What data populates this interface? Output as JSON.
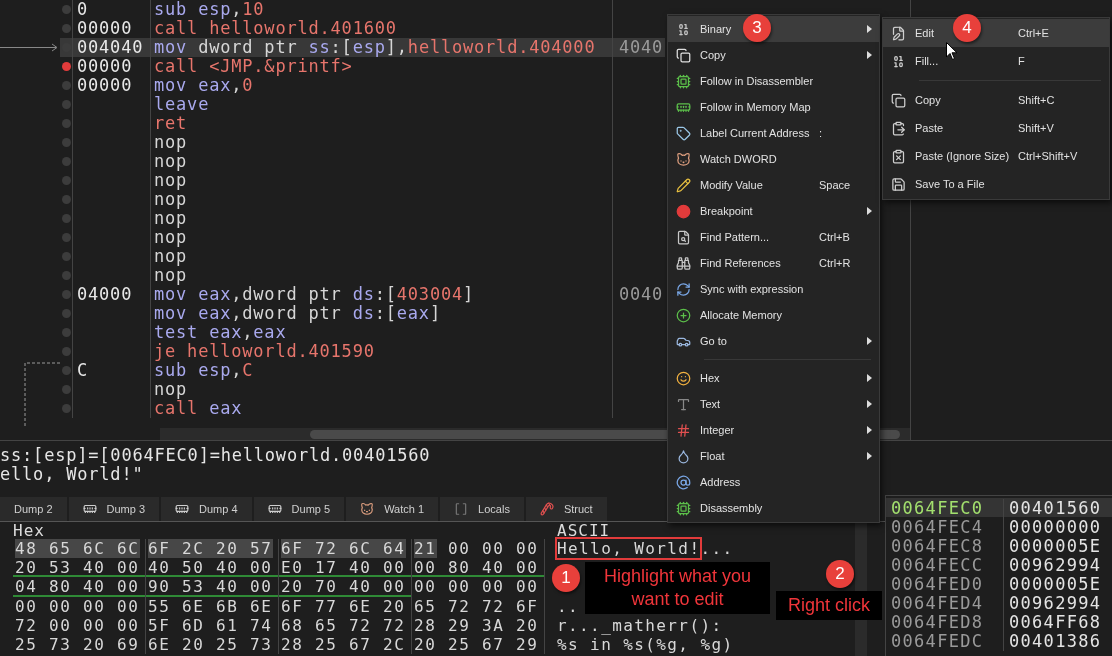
{
  "disassembly": {
    "rows": [
      {
        "address": "0",
        "selected": false,
        "breakpoint": false,
        "instruction": [
          {
            "text": "sub",
            "kind": "op"
          },
          {
            "text": " esp",
            "kind": "reg"
          },
          {
            "text": ",",
            "kind": "plain"
          },
          {
            "text": "10",
            "kind": "num"
          }
        ]
      },
      {
        "address": "00000",
        "selected": false,
        "breakpoint": false,
        "instruction": [
          {
            "text": "call",
            "kind": "flow"
          },
          {
            "text": " helloworld.401600",
            "kind": "num"
          }
        ]
      },
      {
        "address": "004040",
        "selected": true,
        "breakpoint": false,
        "instruction": [
          {
            "text": "mov",
            "kind": "op"
          },
          {
            "text": " dword ptr ",
            "kind": "plain"
          },
          {
            "text": "ss",
            "kind": "reg"
          },
          {
            "text": ":[",
            "kind": "plain"
          },
          {
            "text": "esp",
            "kind": "reg"
          },
          {
            "text": "],",
            "kind": "plain"
          },
          {
            "text": "helloworld.404000",
            "kind": "num"
          }
        ],
        "extra": "4040"
      },
      {
        "address": "00000",
        "selected": false,
        "breakpoint": true,
        "instruction": [
          {
            "text": "call",
            "kind": "flow"
          },
          {
            "text": " <JMP.&printf>",
            "kind": "num"
          }
        ]
      },
      {
        "address": "00000",
        "selected": false,
        "breakpoint": false,
        "instruction": [
          {
            "text": "mov",
            "kind": "op"
          },
          {
            "text": " eax",
            "kind": "reg"
          },
          {
            "text": ",",
            "kind": "plain"
          },
          {
            "text": "0",
            "kind": "num"
          }
        ]
      },
      {
        "selected": false,
        "breakpoint": false,
        "instruction": [
          {
            "text": "leave",
            "kind": "op"
          }
        ]
      },
      {
        "selected": false,
        "breakpoint": false,
        "instruction": [
          {
            "text": "ret",
            "kind": "flow"
          }
        ]
      },
      {
        "selected": false,
        "breakpoint": false,
        "instruction": [
          {
            "text": "nop",
            "kind": "plain"
          }
        ]
      },
      {
        "selected": false,
        "breakpoint": false,
        "instruction": [
          {
            "text": "nop",
            "kind": "plain"
          }
        ]
      },
      {
        "selected": false,
        "breakpoint": false,
        "instruction": [
          {
            "text": "nop",
            "kind": "plain"
          }
        ]
      },
      {
        "selected": false,
        "breakpoint": false,
        "instruction": [
          {
            "text": "nop",
            "kind": "plain"
          }
        ]
      },
      {
        "selected": false,
        "breakpoint": false,
        "instruction": [
          {
            "text": "nop",
            "kind": "plain"
          }
        ]
      },
      {
        "selected": false,
        "breakpoint": false,
        "instruction": [
          {
            "text": "nop",
            "kind": "plain"
          }
        ]
      },
      {
        "selected": false,
        "breakpoint": false,
        "instruction": [
          {
            "text": "nop",
            "kind": "plain"
          }
        ]
      },
      {
        "selected": false,
        "breakpoint": false,
        "instruction": [
          {
            "text": "nop",
            "kind": "plain"
          }
        ]
      },
      {
        "address": "04000",
        "selected": false,
        "breakpoint": false,
        "instruction": [
          {
            "text": "mov",
            "kind": "op"
          },
          {
            "text": " eax",
            "kind": "reg"
          },
          {
            "text": ",dword ptr ",
            "kind": "plain"
          },
          {
            "text": "ds",
            "kind": "reg"
          },
          {
            "text": ":[",
            "kind": "plain"
          },
          {
            "text": "403004",
            "kind": "num"
          },
          {
            "text": "]",
            "kind": "plain"
          }
        ],
        "extra": "0040"
      },
      {
        "selected": false,
        "breakpoint": false,
        "instruction": [
          {
            "text": "mov",
            "kind": "op"
          },
          {
            "text": " eax",
            "kind": "reg"
          },
          {
            "text": ",dword ptr ",
            "kind": "plain"
          },
          {
            "text": "ds",
            "kind": "reg"
          },
          {
            "text": ":[",
            "kind": "plain"
          },
          {
            "text": "eax",
            "kind": "reg"
          },
          {
            "text": "]",
            "kind": "plain"
          }
        ]
      },
      {
        "selected": false,
        "breakpoint": false,
        "instruction": [
          {
            "text": "test",
            "kind": "op"
          },
          {
            "text": " eax",
            "kind": "reg"
          },
          {
            "text": ",",
            "kind": "plain"
          },
          {
            "text": "eax",
            "kind": "reg"
          }
        ]
      },
      {
        "selected": false,
        "breakpoint": false,
        "instruction": [
          {
            "text": "je",
            "kind": "flow"
          },
          {
            "text": " helloworld.401590",
            "kind": "num"
          }
        ]
      },
      {
        "address": "C",
        "selected": false,
        "breakpoint": false,
        "instruction": [
          {
            "text": "sub",
            "kind": "op"
          },
          {
            "text": " esp",
            "kind": "reg"
          },
          {
            "text": ",",
            "kind": "plain"
          },
          {
            "text": "C",
            "kind": "num"
          }
        ]
      },
      {
        "selected": false,
        "breakpoint": false,
        "instruction": [
          {
            "text": "nop",
            "kind": "plain"
          }
        ]
      },
      {
        "selected": false,
        "breakpoint": false,
        "instruction": [
          {
            "text": "call",
            "kind": "flow"
          },
          {
            "text": " eax",
            "kind": "reg"
          }
        ]
      }
    ]
  },
  "info": [
    "ss:[esp]=[0064FEC0]=helloworld.00401560",
    "ello, World!\""
  ],
  "tabs": [
    {
      "label": "Dump 2",
      "selected": false
    },
    {
      "label": "Dump 3",
      "selected": false
    },
    {
      "label": "Dump 4",
      "selected": false
    },
    {
      "label": "Dump 5",
      "selected": false
    },
    {
      "label": "Watch 1",
      "selected": false
    },
    {
      "label": "Locals",
      "selected": false
    },
    {
      "label": "Struct",
      "selected": false
    }
  ],
  "dump": {
    "hex_header": "Hex",
    "ascii_header": "ASCII",
    "rows": [
      {
        "groups": [
          {
            "underlined": false,
            "spans": [
              {
                "text": "48 65 6C 6C",
                "selected": true
              }
            ]
          },
          {
            "underlined": false,
            "spans": [
              {
                "text": "6F 2C 20 57",
                "selected": true
              }
            ]
          },
          {
            "underlined": false,
            "spans": [
              {
                "text": "6F 72 6C 64",
                "selected": true
              }
            ]
          },
          {
            "underlined": false,
            "spans": [
              {
                "text": "21",
                "selected": true
              },
              {
                "text": " 00 00 00",
                "selected": false
              }
            ]
          }
        ],
        "ascii": [
          {
            "text": "Hello, World!",
            "outlined": true
          },
          {
            "text": "...",
            "outlined": false
          }
        ]
      },
      {
        "groups": [
          {
            "underlined": true,
            "spans": [
              {
                "text": "20 53 40 00",
                "selected": false
              }
            ]
          },
          {
            "underlined": true,
            "spans": [
              {
                "text": "40 50 40 00",
                "selected": false
              }
            ]
          },
          {
            "underlined": true,
            "spans": [
              {
                "text": "E0 17 40 00",
                "selected": false
              }
            ]
          },
          {
            "underlined": true,
            "spans": [
              {
                "text": "00 80 40 00",
                "selected": false
              }
            ]
          }
        ]
      },
      {
        "groups": [
          {
            "underlined": true,
            "spans": [
              {
                "text": "04 80 40 00",
                "selected": false
              }
            ]
          },
          {
            "underlined": true,
            "spans": [
              {
                "text": "90 53 40 00",
                "selected": false
              }
            ]
          },
          {
            "underlined": true,
            "spans": [
              {
                "text": "20 70 40 00",
                "selected": false
              }
            ]
          },
          {
            "underlined": false,
            "spans": [
              {
                "text": "00 00 00 00",
                "selected": false
              }
            ]
          }
        ]
      },
      {
        "groups": [
          {
            "underlined": false,
            "spans": [
              {
                "text": "00 00 00 00",
                "selected": false
              }
            ]
          },
          {
            "underlined": false,
            "spans": [
              {
                "text": "55 6E 6B 6E",
                "selected": false
              }
            ]
          },
          {
            "underlined": false,
            "spans": [
              {
                "text": "6F 77 6E 20",
                "selected": false
              }
            ]
          },
          {
            "underlined": false,
            "spans": [
              {
                "text": "65 72 72 6F",
                "selected": false
              }
            ]
          }
        ],
        "ascii": [
          {
            "text": "..",
            "outlined": false
          }
        ]
      },
      {
        "groups": [
          {
            "underlined": false,
            "spans": [
              {
                "text": "72 00 00 00",
                "selected": false
              }
            ]
          },
          {
            "underlined": false,
            "spans": [
              {
                "text": "5F 6D 61 74",
                "selected": false
              }
            ]
          },
          {
            "underlined": false,
            "spans": [
              {
                "text": "68 65 72 72",
                "selected": false
              }
            ]
          },
          {
            "underlined": false,
            "spans": [
              {
                "text": "28 29 3A 20",
                "selected": false
              }
            ]
          }
        ],
        "ascii": [
          {
            "text": "r..._matherr():",
            "outlined": false
          }
        ]
      },
      {
        "groups": [
          {
            "underlined": false,
            "spans": [
              {
                "text": "25 73 20 69",
                "selected": false
              }
            ]
          },
          {
            "underlined": false,
            "spans": [
              {
                "text": "6E 20 25 73",
                "selected": false
              }
            ]
          },
          {
            "underlined": false,
            "spans": [
              {
                "text": "28 25 67 2C",
                "selected": false
              }
            ]
          },
          {
            "underlined": false,
            "spans": [
              {
                "text": "20 25 67 29",
                "selected": false
              }
            ]
          }
        ],
        "ascii": [
          {
            "text": "%s in %s(%g, %g)",
            "outlined": false
          }
        ]
      }
    ]
  },
  "stack": [
    {
      "address": "0064FEC0",
      "value": "00401560",
      "selected": true
    },
    {
      "address": "0064FEC4",
      "value": "00000000",
      "selected": false
    },
    {
      "address": "0064FEC8",
      "value": "0000005E",
      "selected": false
    },
    {
      "address": "0064FECC",
      "value": "00962994",
      "selected": false
    },
    {
      "address": "0064FED0",
      "value": "0000005E",
      "selected": false
    },
    {
      "address": "0064FED4",
      "value": "00962994",
      "selected": false
    },
    {
      "address": "0064FED8",
      "value": "0064FF68",
      "selected": false
    },
    {
      "address": "0064FEDC",
      "value": "00401386",
      "selected": false
    }
  ],
  "context_menu": {
    "items": [
      {
        "label": "Binary",
        "selected": true,
        "submenu": true
      },
      {
        "label": "Copy",
        "selected": false,
        "submenu": true
      },
      {
        "label": "Follow in Disassembler",
        "selected": false,
        "submenu": false
      },
      {
        "label": "Follow in Memory Map",
        "selected": false,
        "submenu": false
      },
      {
        "label": "Label Current Address",
        "shortcut": ":",
        "selected": false,
        "submenu": false
      },
      {
        "label": "Watch DWORD",
        "selected": false,
        "submenu": false
      },
      {
        "label": "Modify Value",
        "shortcut": "Space",
        "selected": false,
        "submenu": false
      },
      {
        "label": "Breakpoint",
        "selected": false,
        "submenu": true
      },
      {
        "label": "Find Pattern...",
        "shortcut": "Ctrl+B",
        "selected": false,
        "submenu": false
      },
      {
        "label": "Find References",
        "shortcut": "Ctrl+R",
        "selected": false,
        "submenu": false
      },
      {
        "label": "Sync with expression",
        "selected": false,
        "submenu": false
      },
      {
        "label": "Allocate Memory",
        "selected": false,
        "submenu": false
      },
      {
        "label": "Go to",
        "selected": false,
        "submenu": true
      },
      {
        "label": "Hex",
        "selected": false,
        "submenu": true,
        "separator_before": true
      },
      {
        "label": "Text",
        "selected": false,
        "submenu": true
      },
      {
        "label": "Integer",
        "selected": false,
        "submenu": true
      },
      {
        "label": "Float",
        "selected": false,
        "submenu": true
      },
      {
        "label": "Address",
        "selected": false,
        "submenu": false
      },
      {
        "label": "Disassembly",
        "selected": false,
        "submenu": false
      }
    ]
  },
  "submenu": {
    "items": [
      {
        "label": "Edit",
        "shortcut": "Ctrl+E",
        "selected": true
      },
      {
        "label": "Fill...",
        "shortcut": "F",
        "selected": false
      },
      {
        "label": "Copy",
        "shortcut": "Shift+C",
        "selected": false,
        "separator_before": true
      },
      {
        "label": "Paste",
        "shortcut": "Shift+V",
        "selected": false
      },
      {
        "label": "Paste (Ignore Size)",
        "shortcut": "Ctrl+Shift+V",
        "selected": false
      },
      {
        "label": "Save To a File",
        "selected": false
      }
    ]
  },
  "annotations": {
    "steps": [
      "1",
      "2",
      "3",
      "4"
    ],
    "notes": [
      "Highlight what you want to edit",
      "Right click"
    ]
  }
}
